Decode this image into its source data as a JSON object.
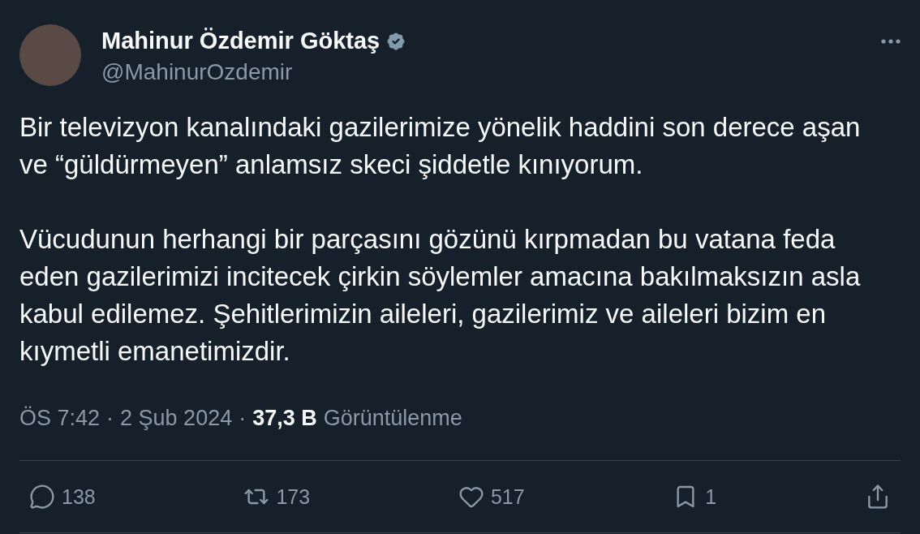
{
  "author": {
    "name": "Mahinur Özdemir Göktaş",
    "verified": true,
    "handle": "@MahinurOzdemir"
  },
  "paragraphs": [
    "Bir televizyon kanalındaki gazilerimize yönelik haddini son derece aşan ve “güldürmeyen” anlamsız skeci şiddetle kınıyorum.",
    "Vücudunun herhangi bir parçasını gözünü kırpmadan bu vatana feda eden gazilerimizi incitecek çirkin söylemler amacına bakılmaksızın asla kabul edilemez. Şehitlerimizin aileleri, gazilerimiz ve aileleri bizim en kıymetli emanetimizdir."
  ],
  "meta": {
    "separator": "·",
    "time": "ÖS 7:42",
    "date": "2 Şub 2024",
    "views_count": "37,3 B",
    "views_label": "Görüntülenme"
  },
  "actions": [
    {
      "kind": "reply",
      "count": "138"
    },
    {
      "kind": "repost",
      "count": "173"
    },
    {
      "kind": "like",
      "count": "517"
    },
    {
      "kind": "bookmark",
      "count": "1"
    },
    {
      "kind": "share"
    }
  ]
}
